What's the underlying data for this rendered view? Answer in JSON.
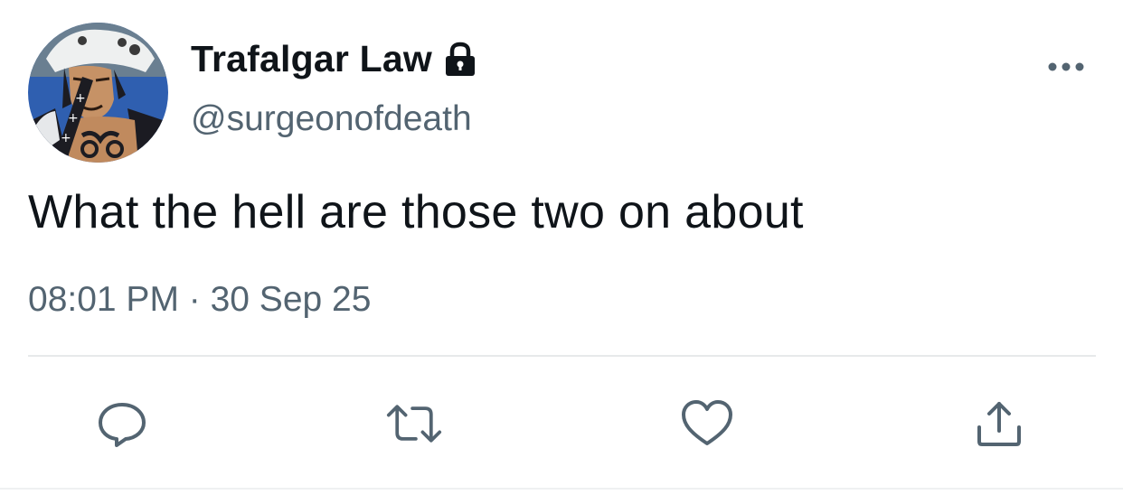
{
  "tweet": {
    "display_name": "Trafalgar Law",
    "handle": "@surgeonofdeath",
    "text": "What the hell are those two on about",
    "timestamp": "08:01 PM · 30 Sep 25",
    "protected_account": true
  },
  "icons": {
    "lock": "lock-icon",
    "more": "more-options-icon",
    "reply": "reply-icon",
    "retweet": "retweet-icon",
    "like": "heart-icon",
    "share": "share-icon"
  },
  "colors": {
    "text_primary": "#0f1419",
    "text_secondary": "#536471",
    "icon": "#536471",
    "divider": "#e7e9ea"
  }
}
